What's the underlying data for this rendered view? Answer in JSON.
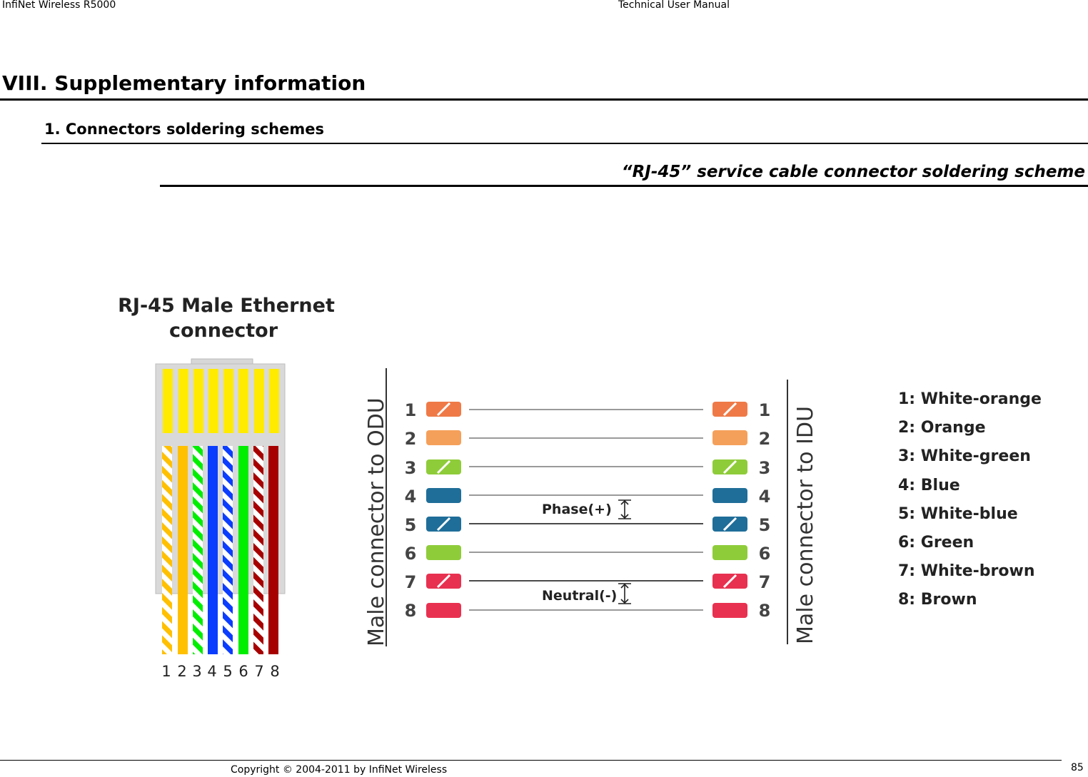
{
  "header": {
    "left": "InfiNet Wireless R5000",
    "right": "Technical User Manual"
  },
  "section": {
    "title": "VIII. Supplementary information",
    "subsection": "1. Connectors soldering schemes",
    "figure_title": "“RJ-45” service cable connector soldering scheme"
  },
  "diagram": {
    "connector_title_line1": "RJ-45 Male Ethernet",
    "connector_title_line2": "connector",
    "pin_numbers": [
      "1",
      "2",
      "3",
      "4",
      "5",
      "6",
      "7",
      "8"
    ],
    "left_vertical_label": "Male connector to ODU",
    "right_vertical_label": "Male connector to IDU",
    "phase_label": "Phase(+)",
    "neutral_label": "Neutral(-)",
    "legend": [
      "1: White-orange",
      "2: Orange",
      "3: White-green",
      "4: Blue",
      "5: White-blue",
      "6: Green",
      "7: White-brown",
      "8: Brown"
    ],
    "colors": {
      "orange": "#f5a05a",
      "orange_stripe": "#ef7a47",
      "green": "#8fcc3a",
      "blue": "#1f6e99",
      "red": "#e83150",
      "plug_yellow": "#ffeb00",
      "wire_orange": "#ffc000",
      "wire_green": "#00ee00",
      "wire_blue": "#0b3dff",
      "wire_brown": "#a70000"
    }
  },
  "footer": {
    "copyright": "Copyright © 2004-2011 by InfiNet Wireless",
    "page": "85"
  }
}
